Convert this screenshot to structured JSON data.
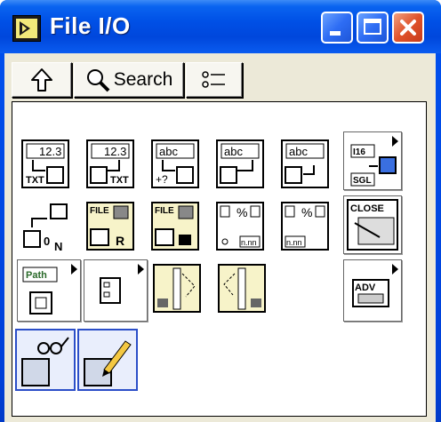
{
  "window": {
    "title": "File I/O",
    "controls": {
      "minimize": "minimize",
      "maximize": "maximize",
      "close": "close"
    }
  },
  "toolbar": {
    "up_icon": "up-arrow-icon",
    "search_label": "Search",
    "options_icon": "view-options-icon"
  },
  "palette": {
    "rows": [
      [
        "Write to Spreadsheet File",
        "Read From Spreadsheet File",
        "Write Characters To File",
        "Read Characters From File",
        "Read Lines From File",
        "Binary File VIs"
      ],
      [
        "Open/Create/Replace File",
        "Read File",
        "Write File",
        "Format Into File",
        "Scan From File",
        "Close File"
      ],
      [
        "File Constants",
        "Configuration File VIs",
        "Write To Measurement File",
        "Read From Measurement File",
        "Advanced File Functions"
      ],
      [
        "Read LabVIEW Measurement File",
        "Write LabVIEW Measurement File"
      ]
    ],
    "text_glyphs": {
      "num": "12.3",
      "abc": "abc",
      "txt": "TXT",
      "file": "FILE",
      "close": "CLOSE",
      "path": "Path",
      "adv": "ADV",
      "i16": "I16",
      "sgl": "SGL",
      "nnn": "n.nn",
      "pct": "%"
    }
  }
}
